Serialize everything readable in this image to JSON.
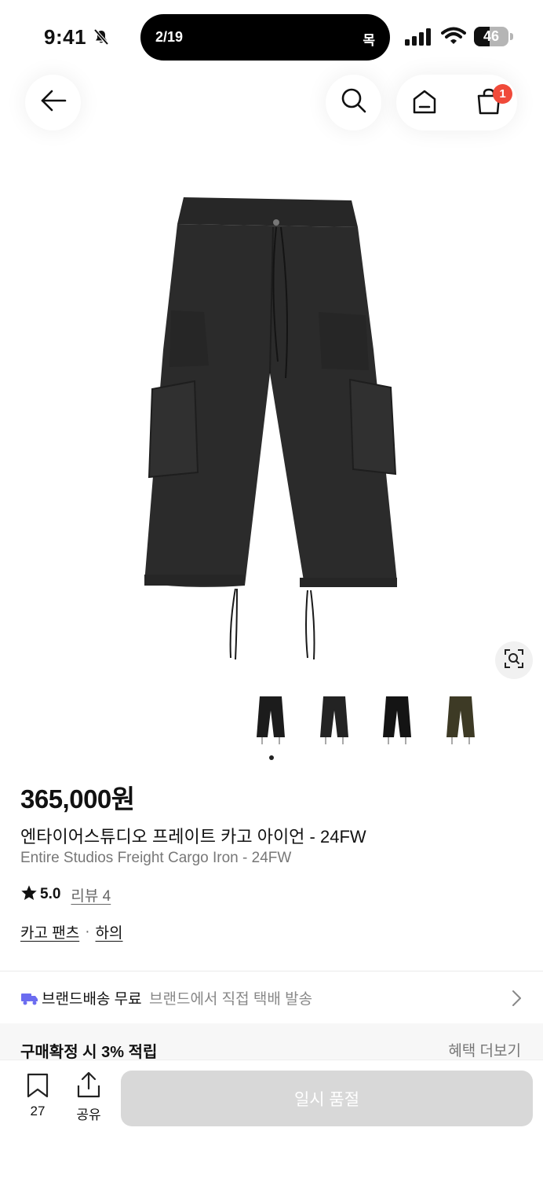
{
  "status_bar": {
    "time": "9:41",
    "island_page": "2/19",
    "island_day": "목",
    "battery": "46",
    "battery_level": 0.46
  },
  "nav": {
    "cart_badge": "1"
  },
  "gallery": {
    "thumbnail_colors": [
      "#1c1c1c",
      "#232323",
      "#141414",
      "#3d3a25"
    ],
    "active_index": 0
  },
  "product": {
    "price": "365,000원",
    "name_ko": "엔타이어스튜디오 프레이트 카고 아이언 - 24FW",
    "name_en": "Entire Studios Freight Cargo Iron - 24FW",
    "rating": "5.0",
    "review_label": "리뷰 4",
    "category_1": "카고 팬츠",
    "category_sep": "·",
    "category_2": "하의"
  },
  "shipping": {
    "label": "브랜드배송 무료",
    "desc": "브랜드에서 직접 택배 발송"
  },
  "benefit": {
    "label": "구매확정 시 3% 적립",
    "more": "혜택 더보기"
  },
  "bottom_bar": {
    "bookmark_count": "27",
    "share_label": "공유",
    "cta_label": "일시 품절"
  },
  "colors": {
    "badge": "#f04a3a",
    "cta_disabled": "#d8d8d8",
    "shipping_accent": "#6b6cf0"
  }
}
